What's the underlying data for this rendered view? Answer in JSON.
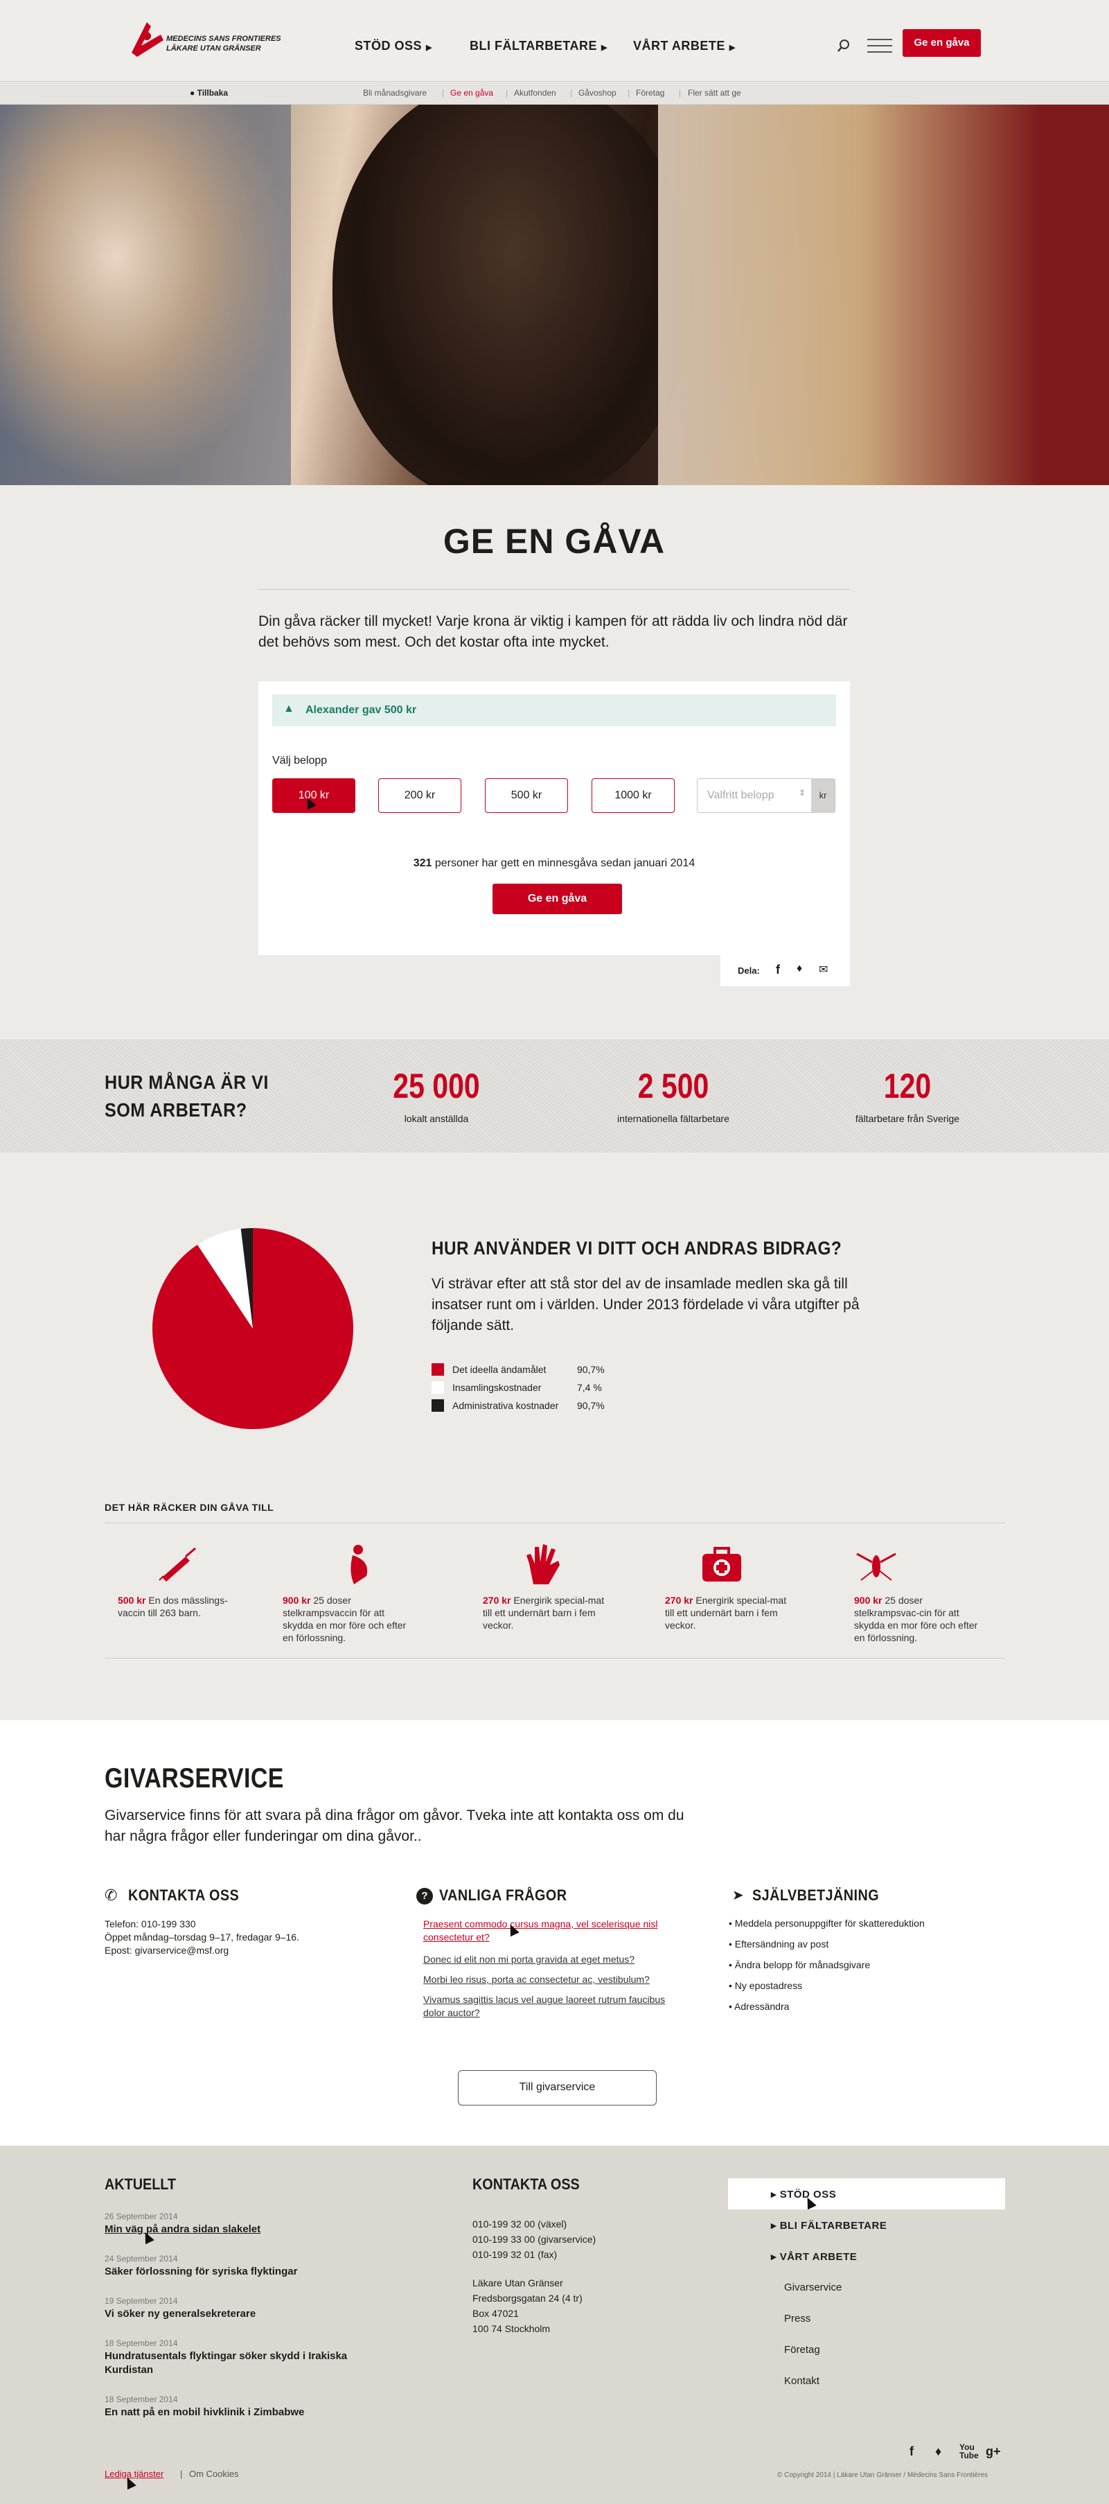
{
  "header": {
    "logo_line1": "MEDECINS SANS FRONTIERES",
    "logo_line2": "LÄKARE UTAN GRÄNSER",
    "nav": [
      "STÖD OSS",
      "BLI FÄLTARBETARE",
      "VÅRT ARBETE"
    ],
    "donate_label": "Ge en gåva"
  },
  "subnav": {
    "back_label": "Tillbaka",
    "items": [
      "Bli månadsgivare",
      "Ge en gåva",
      "Akutfonden",
      "Gåvoshop",
      "Företag",
      "Fler sätt att ge"
    ]
  },
  "donate": {
    "title": "GE EN GÅVA",
    "intro": "Din gåva räcker till mycket! Varje krona är viktig i kampen för att rädda liv och lindra nöd där det behövs som mest. Och det kostar ofta inte mycket.",
    "recent_gift": "Alexander gav 500 kr",
    "choose_label": "Välj belopp",
    "amounts": [
      "100 kr",
      "200 kr",
      "500 kr",
      "1000 kr"
    ],
    "custom_placeholder": "Valfritt belopp",
    "currency": "kr",
    "count": "321",
    "count_text": " personer har gett en minnesgåva sedan januari 2014",
    "submit_label": "Ge en gåva",
    "share_label": "Dela:"
  },
  "stats": {
    "heading": "HUR MÅNGA ÄR VI SOM ARBETAR?",
    "items": [
      {
        "value": "25 000",
        "label": "lokalt anställda"
      },
      {
        "value": "2 500",
        "label": "internationella fältarbetare"
      },
      {
        "value": "120",
        "label": "fältarbetare från Sverige"
      }
    ]
  },
  "usage": {
    "heading": "HUR ANVÄNDER VI DITT OCH ANDRAS BIDRAG?",
    "text": "Vi strävar efter att stå stor del av de insamlade medlen ska gå till insatser runt om i världen. Under 2013 fördelade vi våra utgifter på följande sätt."
  },
  "chart_data": {
    "type": "pie",
    "categories": [
      "Det ideella ändamålet",
      "Insamlingskostnader",
      "Administrativa kostnader"
    ],
    "values": [
      90.7,
      7.4,
      90.7
    ],
    "value_labels": [
      "90,7%",
      "7,4 %",
      "90,7%"
    ],
    "pie_share": [
      90.7,
      7.4,
      1.9
    ],
    "colors": [
      "#c8001e",
      "#ffffff",
      "#1d1d1b"
    ],
    "legend": "right"
  },
  "impact": {
    "heading": "DET HÄR RÄCKER DIN GÅVA TILL",
    "items": [
      {
        "icon": "syringe-icon",
        "amount": "500 kr",
        "text": "En dos mässlings-vaccin till 263 barn."
      },
      {
        "icon": "pregnant-icon",
        "amount": "900 kr",
        "text": "25 doser stelkrampsvaccin för att skydda en mor före och efter en förlossning."
      },
      {
        "icon": "hand-icon",
        "amount": "270 kr",
        "text": "Energirik special-mat till ett undernärt barn i fem veckor."
      },
      {
        "icon": "first-aid-icon",
        "amount": "270 kr",
        "text": "Energirik special-mat till ett undernärt barn i fem veckor."
      },
      {
        "icon": "mosquito-icon",
        "amount": "900 kr",
        "text": "25 doser stelkrampsvac-cin för att skydda en mor före och efter en förlossning."
      }
    ]
  },
  "givarservice": {
    "title": "GIVARSERVICE",
    "intro": "Givarservice finns för att svara på dina frågor om gåvor. Tveka inte att kontakta oss om du har några frågor eller funderingar om dina gåvor..",
    "contact": {
      "heading": "KONTAKTA OSS",
      "lines": [
        "Telefon: 010-199 330",
        "Öppet måndag–torsdag 9–17, fredagar 9–16.",
        "Epost: givarservice@msf.org"
      ]
    },
    "faq": {
      "heading": "VANLIGA FRÅGOR",
      "items": [
        "Praesent commodo cursus magna, vel scelerisque nisl consectetur et?",
        "Donec id elit non mi porta gravida at eget metus?",
        "Morbi leo risus, porta ac consectetur ac, vestibulum?",
        "Vivamus sagittis lacus vel augue laoreet rutrum faucibus dolor auctor?"
      ]
    },
    "self": {
      "heading": "SJÄLVBETJÄNING",
      "items": [
        "Meddela personuppgifter för skattereduktion",
        "Eftersändning av post",
        "Ändra belopp för månadsgivare",
        "Ny epostadress",
        "Adressändra"
      ]
    },
    "button_label": "Till givarservice"
  },
  "footer": {
    "news_heading": "AKTUELLT",
    "news": [
      {
        "date": "26 September 2014",
        "title": "Min väg på andra sidan slakelet"
      },
      {
        "date": "24 September 2014",
        "title": "Säker förlossning för syriska flyktingar"
      },
      {
        "date": "19 September 2014",
        "title": "Vi söker ny generalsekreterare"
      },
      {
        "date": "18 September 2014",
        "title": "Hundratusentals flyktingar söker skydd i Irakiska Kurdistan"
      },
      {
        "date": "18 September 2014",
        "title": "En natt på en mobil hivklinik i Zimbabwe"
      }
    ],
    "contact_heading": "KONTAKTA OSS",
    "phones": [
      "010-199 32 00 (växel)",
      "010-199 33 00 (givarservice)",
      "010-199 32 01 (fax)"
    ],
    "address": [
      "Läkare Utan Gränser",
      "Fredsborgsgatan 24 (4 tr)",
      "Box 47021",
      "100 74 Stockholm"
    ],
    "nav_bold": [
      "STÖD OSS",
      "BLI FÄLTARBETARE",
      "VÅRT ARBETE"
    ],
    "nav_plain": [
      "Givarservice",
      "Press",
      "Företag",
      "Kontakt"
    ],
    "links": [
      "Lediga tjänster",
      "Om Cookies"
    ],
    "copyright": "© Copyright 2014 | Läkare Utan Gränser / Médecins Sans Frontières"
  }
}
